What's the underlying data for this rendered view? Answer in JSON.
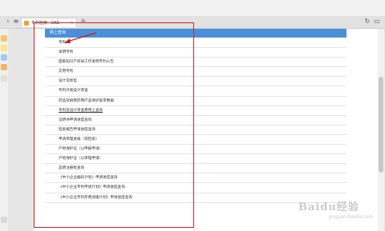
{
  "browser": {
    "tab_title": "专利检索 - DSS",
    "new_tab": "+"
  },
  "panel": {
    "header": "网上查询",
    "items": [
      {
        "label": "专利"
      },
      {
        "label": "发明专利"
      },
      {
        "label": "国家知识产权局工作发明专利公告"
      },
      {
        "label": "实用专利"
      },
      {
        "label": "设计及新型"
      },
      {
        "label": "专利外观设计审查"
      },
      {
        "label": "药品及植物药用产品保护复审数据"
      },
      {
        "label": "专利及设计审查费用上查询"
      },
      {
        "label": "证明书申请进度查询"
      },
      {
        "label": "检索报告申请进度查询"
      },
      {
        "label": "申请审理进展（或检索）"
      },
      {
        "label": "产地保护证（以申报申请）"
      },
      {
        "label": "产地保护证（以审理申请）"
      },
      {
        "label": "品牌注册批查询"
      },
      {
        "label": "《中小企业编码计划》申请进度查询"
      },
      {
        "label": "《中小企业专利申请计划》申请进度查询"
      },
      {
        "label": "《中小企业专利年费减缓计划》申请进度查询"
      }
    ]
  },
  "watermark": {
    "text": "Baidu经验",
    "sub": "jingyan.baidu.com"
  },
  "colors": {
    "accent": "#4a90d9",
    "highlight_frame": "#d12222"
  }
}
